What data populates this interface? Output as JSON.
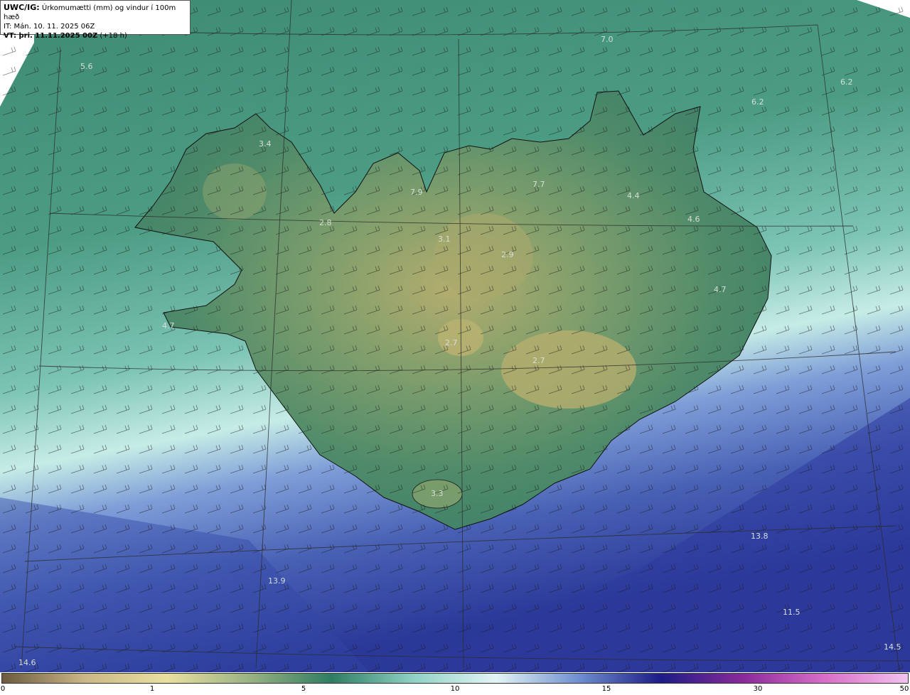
{
  "header": {
    "product_code": "UWC/IG:",
    "title": "Úrkomumætti (mm) og vindur í 100m hæð",
    "init_time": "IT: Mán. 10. 11. 2025 06Z",
    "valid_prefix": "VT: þri. 11.11.2025 00Z",
    "valid_offset": "(+18 h)"
  },
  "colorbar": {
    "ticks": [
      "0",
      "1",
      "5",
      "10",
      "15",
      "30",
      "50"
    ],
    "colors": [
      "#6b5a3e",
      "#c9b886",
      "#e9e0a0",
      "#9ab383",
      "#2e7d62",
      "#8fd2c5",
      "#e3f5f5",
      "#6f8fcf",
      "#1c1c86",
      "#8a2a9a",
      "#d96fc8",
      "#f2c2ee"
    ]
  },
  "values": [
    {
      "text": "5.6",
      "loc": "nw-sea"
    },
    {
      "text": "7.0",
      "loc": "n-sea"
    },
    {
      "text": "6.2",
      "loc": "ne-sea-outer"
    },
    {
      "text": "6.2",
      "loc": "ne-sea"
    },
    {
      "text": "3.4",
      "loc": "westfjords"
    },
    {
      "text": "7.9",
      "loc": "north-1"
    },
    {
      "text": "7.7",
      "loc": "north-2"
    },
    {
      "text": "4.4",
      "loc": "northeast"
    },
    {
      "text": "4.6",
      "loc": "east-1"
    },
    {
      "text": "2.8",
      "loc": "west-1"
    },
    {
      "text": "3.1",
      "loc": "central-1"
    },
    {
      "text": "2.9",
      "loc": "central-2"
    },
    {
      "text": "4.7",
      "loc": "east-2"
    },
    {
      "text": "4.7",
      "loc": "snaefellsnes"
    },
    {
      "text": "2.7",
      "loc": "langjokull"
    },
    {
      "text": "2.7",
      "loc": "vatnajokull"
    },
    {
      "text": "3.3",
      "loc": "myrdalsjokull"
    },
    {
      "text": "13.8",
      "loc": "se-sea"
    },
    {
      "text": "13.9",
      "loc": "s-sea"
    },
    {
      "text": "11.5",
      "loc": "se-sea-2"
    },
    {
      "text": "14.5",
      "loc": "se-corner"
    },
    {
      "text": "14.6",
      "loc": "sw-corner"
    }
  ]
}
